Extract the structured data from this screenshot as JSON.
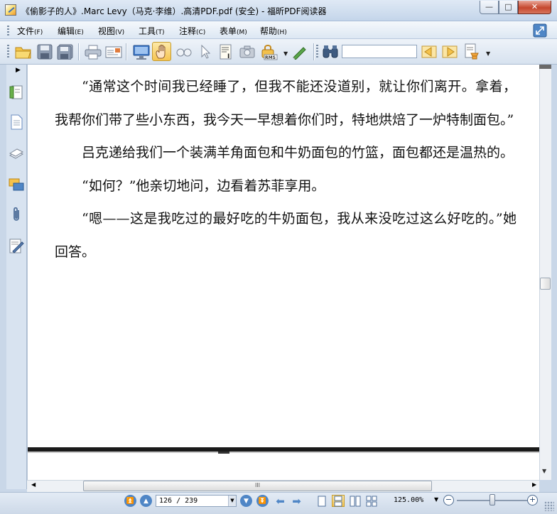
{
  "window": {
    "title": "《偷影子的人》.Marc Levy（马克·李维）.高清PDF.pdf (安全) - 福昕PDF阅读器",
    "min_glyph": "—",
    "max_glyph": "□",
    "close_glyph": "✕"
  },
  "menu": {
    "items": [
      {
        "label": "文件",
        "key": "(F)"
      },
      {
        "label": "编辑",
        "key": "(E)"
      },
      {
        "label": "视图",
        "key": "(V)"
      },
      {
        "label": "工具",
        "key": "(T)"
      },
      {
        "label": "注释",
        "key": "(C)"
      },
      {
        "label": "表单",
        "key": "(M)"
      },
      {
        "label": "帮助",
        "key": "(H)"
      }
    ]
  },
  "toolbar": {
    "search_value": "",
    "active_tool": "hand"
  },
  "document": {
    "paragraphs": [
      {
        "indent": true,
        "text": "“通常这个时间我已经睡了，但我不能还没道别，就让你们离开。拿着，我帮你们带了些小东西，我今天一早想着你们时，特地烘焙了一炉特制面包。”"
      },
      {
        "indent": true,
        "text": "吕克递给我们一个装满羊角面包和牛奶面包的竹篮，面包都还是温热的。"
      },
      {
        "indent": true,
        "text": "“如何？”他亲切地问，边看着苏菲享用。"
      },
      {
        "indent": true,
        "text": "“嗯——这是我吃过的最好吃的牛奶面包，我从来没吃过这么好吃的。”她回答。"
      }
    ]
  },
  "status": {
    "page_indicator": "126 / 239",
    "current_page": 126,
    "total_pages": 239,
    "zoom": "125.00%",
    "zoom_level": 1.25
  },
  "colors": {
    "accent": "#f6c451",
    "chrome": "#dde7f3",
    "nav_blue": "#4f86c6"
  },
  "scroll": {
    "hthumb_glyph": "III"
  }
}
